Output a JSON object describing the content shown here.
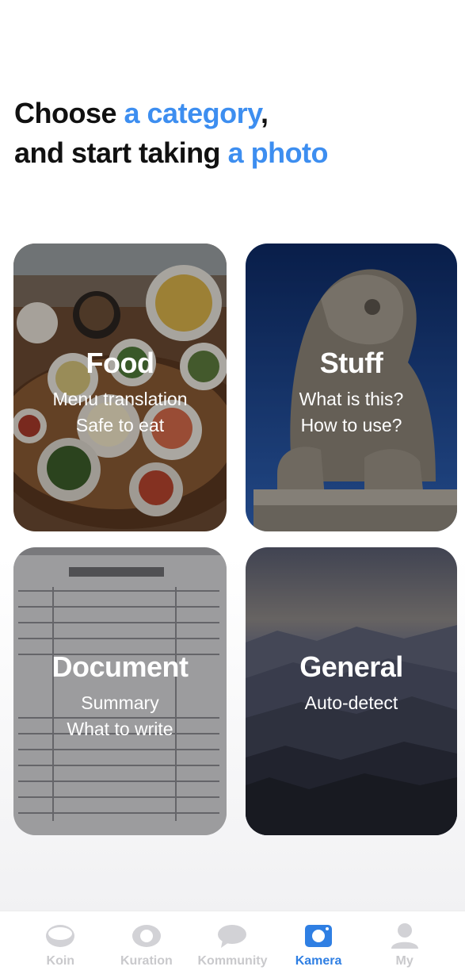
{
  "headline": {
    "line1_plain": "Choose ",
    "line1_accent": "a category",
    "line1_end": ",",
    "line2_plain": "and start taking ",
    "line2_accent": "a photo"
  },
  "cards": {
    "food": {
      "title": "Food",
      "subtitle1": "Menu translation",
      "subtitle2": "Safe to eat"
    },
    "stuff": {
      "title": "Stuff",
      "subtitle1": "What is this?",
      "subtitle2": "How to use?"
    },
    "document": {
      "title": "Document",
      "subtitle1": "Summary",
      "subtitle2": "What to write"
    },
    "general": {
      "title": "General",
      "subtitle1": "Auto-detect"
    }
  },
  "tabbar": {
    "koin": "Koin",
    "kuration": "Kuration",
    "kommunity": "Kommunity",
    "kamera": "Kamera",
    "my": "My",
    "active_tab": "kamera"
  },
  "colors": {
    "accent": "#3d8ef0",
    "active_tab": "#2f7fe3",
    "inactive_tab": "#c9c9cc"
  }
}
